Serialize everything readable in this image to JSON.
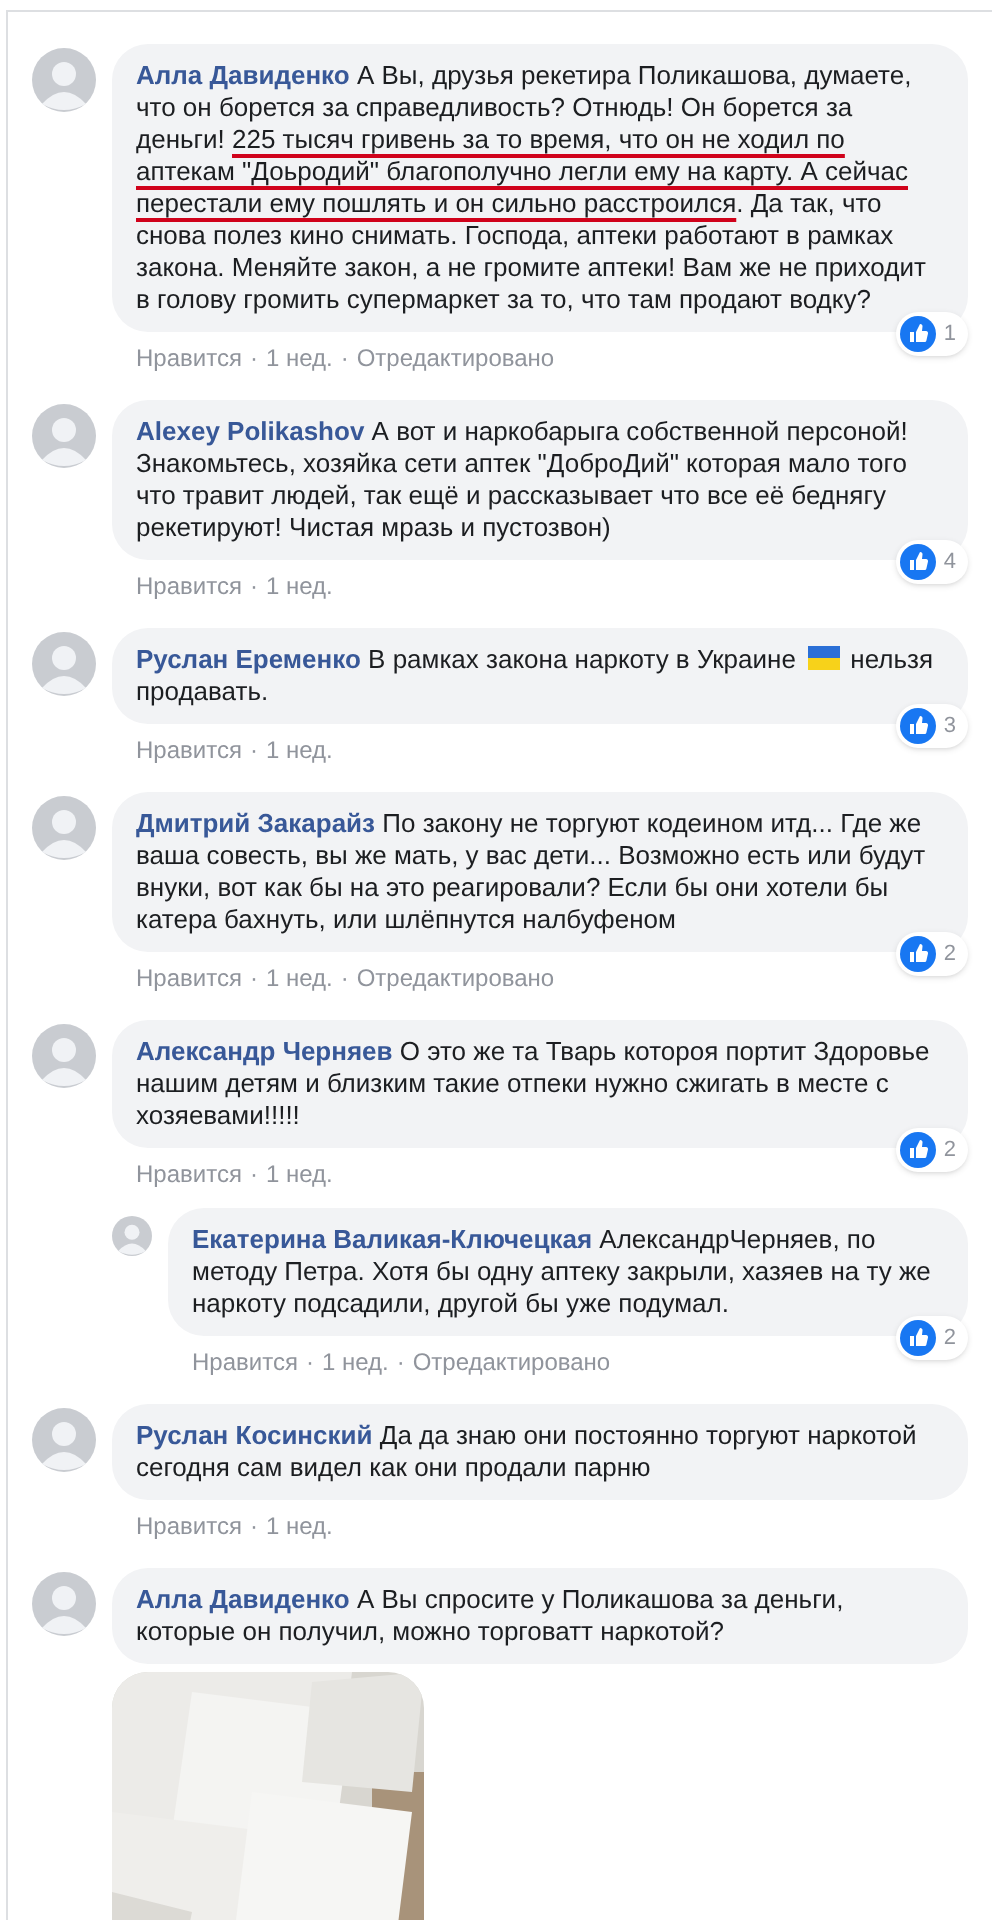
{
  "comments": [
    {
      "author": "Алла Давиденко",
      "parts": [
        {
          "kind": "text",
          "text": "А Вы, друзья рекетира Поликашова, думаете, что он борется за справедливость? Отнюдь! Он борется за деньги! ",
          "underlined": false
        },
        {
          "kind": "text",
          "text": "225 тысяч гривень за то время, что он не ходил по аптекам \"Доьродий\" благополучно легли ему на карту. А сейчас перестали ему пошлять и он сильно расстроился",
          "underlined": true
        },
        {
          "kind": "text",
          "text": ". Да так, что снова полез кино снимать. Господа, аптеки работают в рамках закона. Меняйте закон, а не громите аптеки! Вам же не приходит в голову громить супермаркет за то, что там продают водку?",
          "underlined": false
        }
      ],
      "reactions": "1",
      "actions": [
        "Нравится",
        "·",
        "1 нед.",
        "·",
        "Отредактировано"
      ]
    },
    {
      "author": "Alexey Polikashov",
      "parts": [
        {
          "kind": "text",
          "text": "А вот и наркобарыга собственной персоной! Знакомьтесь, хозяйка сети аптек \"ДоброДий\" которая мало того что травит людей, так ещё и рассказывает что все её беднягу рекетируют! Чистая мразь и пустозвон)",
          "underlined": false
        }
      ],
      "reactions": "4",
      "actions": [
        "Нравится",
        "·",
        "1 нед."
      ]
    },
    {
      "author": "Руслан Еременко",
      "parts": [
        {
          "kind": "text",
          "text": "В рамках закона наркоту в Украине ",
          "underlined": false
        },
        {
          "kind": "flag"
        },
        {
          "kind": "text",
          "text": " нельзя продавать.",
          "underlined": false
        }
      ],
      "reactions": "3",
      "actions": [
        "Нравится",
        "·",
        "1 нед."
      ]
    },
    {
      "author": "Дмитрий Закарайз",
      "parts": [
        {
          "kind": "text",
          "text": "По закону не торгуют кодеином итд... Где же ваша совесть, вы же мать, у вас дети... Возможно есть или будут внуки, вот как бы на это реагировали? Если бы они хотели бы катера бахнуть, или шлёпнутся налбуфеном",
          "underlined": false
        }
      ],
      "reactions": "2",
      "actions": [
        "Нравится",
        "·",
        "1 нед.",
        "·",
        "Отредактировано"
      ]
    },
    {
      "author": "Александр Черняев",
      "parts": [
        {
          "kind": "text",
          "text": "О это же та Тварь котороя портит Здоровье нашим детям и близким такие отпеки нужно сжигать в месте с хозяевами!!!!!",
          "underlined": false
        }
      ],
      "reactions": "2",
      "actions": [
        "Нравится",
        "·",
        "1 нед."
      ],
      "replies": [
        {
          "author": "Екатерина Валикая-Ключецкая",
          "parts": [
            {
              "kind": "text",
              "text": "АлександрЧерняев, по методу Петра. Хотя бы одну аптеку закрыли, хазяев на ту же наркоту подсадили, другой бы уже подумал.",
              "underlined": false
            }
          ],
          "reactions": "2",
          "actions": [
            "Нравится",
            "·",
            "1 нед.",
            "·",
            "Отредактировано"
          ]
        }
      ]
    },
    {
      "author": "Руслан Косинский",
      "parts": [
        {
          "kind": "text",
          "text": "Да да знаю они постоянно торгуют наркотой сегодня сам видел как они продали парню",
          "underlined": false
        }
      ],
      "actions": [
        "Нравится",
        "·",
        "1 нед."
      ]
    },
    {
      "author": "Алла Давиденко",
      "parts": [
        {
          "kind": "text",
          "text": "А Вы спросите у Поликашова за деньги, которые он получил, можно торговатт наркотой?",
          "underlined": false
        }
      ]
    }
  ]
}
